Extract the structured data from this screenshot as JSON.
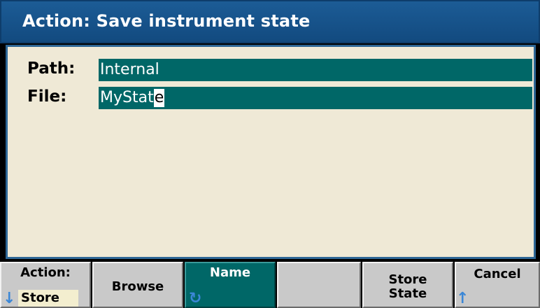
{
  "title": "Action: Save instrument state",
  "fields": {
    "path_label": "Path:",
    "path_value": "Internal",
    "file_label": "File:",
    "file_value_main": "MyStat",
    "file_value_cursor": "e"
  },
  "softkeys": {
    "action_label": "Action:",
    "action_value": "Store",
    "browse_label": "Browse",
    "name_label": "Name",
    "store_state_line1": "Store",
    "store_state_line2": "State",
    "cancel_label": "Cancel"
  },
  "icons": {
    "down_arrow": "down-arrow-icon",
    "up_arrow": "up-arrow-icon",
    "rotate_knob": "rotate-knob-icon"
  },
  "colors": {
    "title_bar": "#1c5c96",
    "panel_background": "#efe9d6",
    "field_background": "#006767",
    "softkey_background": "#c9c9c9",
    "arrow_color": "#3b87d6"
  }
}
